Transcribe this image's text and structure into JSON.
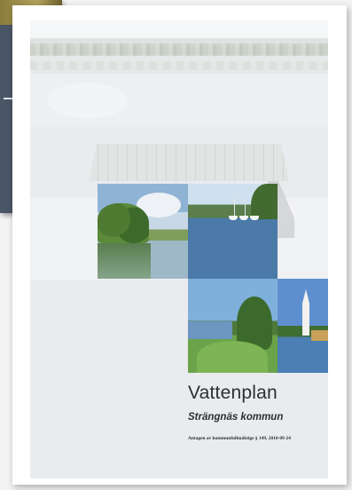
{
  "cover": {
    "title": "Vattenplan",
    "subtitle": "Strängnäs kommun",
    "adopted_line": "Antagen av kommunfullmäktige § 149, 2018-09-24"
  },
  "back_document": {
    "visible_text": ""
  }
}
